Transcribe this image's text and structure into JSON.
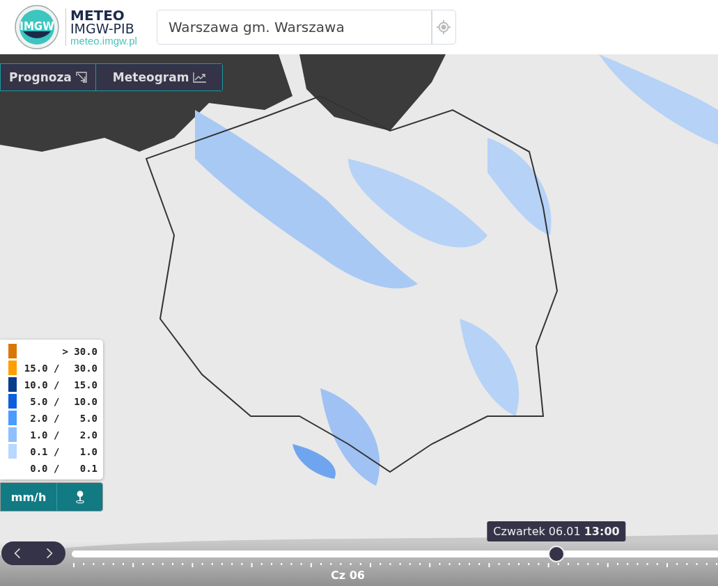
{
  "header": {
    "logo": {
      "text": "IMGW"
    },
    "brand": {
      "title": "METEO",
      "subtitle": "IMGW-PIB",
      "url": "meteo.imgw.pl"
    },
    "search": {
      "value": "Warszawa gm. Warszawa"
    }
  },
  "view_tabs": [
    {
      "label": "Prognoza"
    },
    {
      "label": "Meteogram"
    }
  ],
  "legend": {
    "items": [
      {
        "to": "> 30.0",
        "color": "#d97706"
      },
      {
        "from": "15.0 /",
        "to": "30.0",
        "color": "#ff9f00"
      },
      {
        "from": "10.0 /",
        "to": "15.0",
        "color": "#063c8a"
      },
      {
        "from": "5.0 /",
        "to": "10.0",
        "color": "#0a5fdc"
      },
      {
        "from": "2.0 /",
        "to": "5.0",
        "color": "#4a9bff"
      },
      {
        "from": "1.0 /",
        "to": "2.0",
        "color": "#8fbfff"
      },
      {
        "from": "0.1 /",
        "to": "1.0",
        "color": "#b8d8ff"
      },
      {
        "from": "0.0 /",
        "to": "0.1"
      }
    ],
    "unit": "mm/h"
  },
  "timeline": {
    "tooltip": "Czwartek 06.01 **13:00**",
    "level": 0.75,
    "day_label": "Cz 06"
  }
}
